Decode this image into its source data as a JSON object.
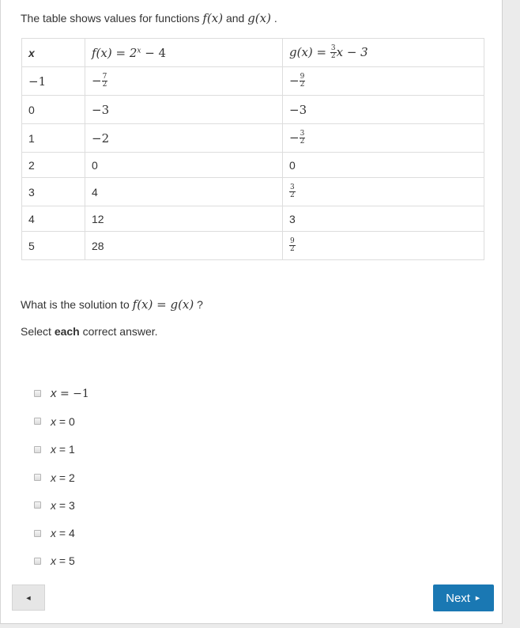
{
  "intro": {
    "prefix": "The table shows values for functions ",
    "f": "f(x)",
    "and": " and ",
    "g": "g(x)",
    "suffix": " ."
  },
  "table": {
    "headers": {
      "x": "x",
      "f": "f(x) = 2",
      "f_exp": "x",
      "f_tail": " − 4",
      "g": "g(x) = ",
      "g_num": "3",
      "g_den": "2",
      "g_tail": "x − 3"
    },
    "rows": [
      {
        "x": "−1",
        "f_sign": "−",
        "f_num": "7",
        "f_den": "2",
        "g_sign": "−",
        "g_num": "9",
        "g_den": "2"
      },
      {
        "x": "0",
        "f": "−3",
        "g": "−3"
      },
      {
        "x": "1",
        "f": "−2",
        "g_sign": "−",
        "g_num": "3",
        "g_den": "2"
      },
      {
        "x": "2",
        "f": "0",
        "g": "0"
      },
      {
        "x": "3",
        "f": "4",
        "g_num": "3",
        "g_den": "2"
      },
      {
        "x": "4",
        "f": "12",
        "g": "3"
      },
      {
        "x": "5",
        "f": "28",
        "g_num": "9",
        "g_den": "2"
      }
    ]
  },
  "question": {
    "prefix": "What is the solution to ",
    "eq": "f(x) = g(x)",
    "suffix": " ?"
  },
  "instruction": {
    "pre": "Select ",
    "bold": "each",
    "post": " correct answer."
  },
  "choices": [
    {
      "var": "x",
      "rest": " = −1"
    },
    {
      "var": "x",
      "rest": " = 0"
    },
    {
      "var": "x",
      "rest": " = 1"
    },
    {
      "var": "x",
      "rest": " = 2"
    },
    {
      "var": "x",
      "rest": " = 3"
    },
    {
      "var": "x",
      "rest": " = 4"
    },
    {
      "var": "x",
      "rest": " = 5"
    }
  ],
  "nav": {
    "prev_icon": "◄",
    "next_label": "Next",
    "next_icon": "►"
  },
  "colors": {
    "next_button": "#1a78b3",
    "background": "#ebebeb"
  }
}
